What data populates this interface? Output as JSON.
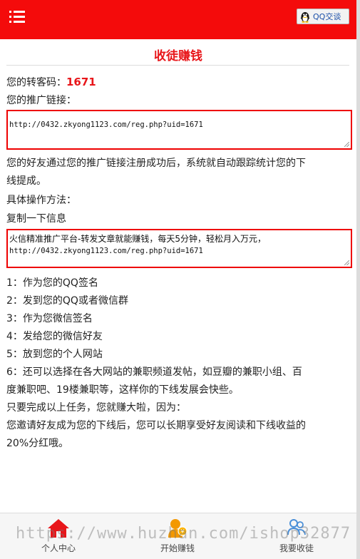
{
  "header": {
    "qq_button_label": "QQ交谈",
    "accent": "#f40b0b"
  },
  "page": {
    "title": "收徒赚钱",
    "code_label": "您的转客码：",
    "code_value": "1671",
    "link_label": "您的推广链接：",
    "link_value": "http://0432.zkyong1123.com/reg.php?uid=1671",
    "description_1": "您的好友通过您的推广链接注册成功后，系统就自动跟踪统计您的下",
    "description_2": "线提成。",
    "method_label": "具体操作方法：",
    "copy_label": "复制一下信息",
    "share_text_line1": "火信精准推广平台-转发文章就能赚钱，每天5分钟，轻松月入万元，",
    "share_text_line2": "http://0432.zkyong1123.com/reg.php?uid=1671",
    "steps": [
      "1：作为您的QQ签名",
      "2：发到您的QQ或者微信群",
      "3：作为您微信签名",
      "4：发给您的微信好友",
      "5：放到您的个人网站"
    ],
    "step6_line1": "6：还可以选择在各大网站的兼职频道发帖，如豆瓣的兼职小组、百",
    "step6_line2": "度兼职吧、19楼兼职等，这样你的下线发展会快些。",
    "summary_1": "只要完成以上任务，您就赚大啦，因为：",
    "summary_2": "您邀请好友成为您的下线后，您可以长期享受好友阅读和下线收益的",
    "summary_3": "20%分红哦。"
  },
  "bottom_nav": {
    "items": [
      {
        "label": "个人中心",
        "icon": "home-icon"
      },
      {
        "label": "开始赚钱",
        "icon": "earn-icon"
      },
      {
        "label": "我要收徒",
        "icon": "recruit-icon"
      }
    ]
  },
  "watermark": "https://www.huzhan.com/ishop32877"
}
